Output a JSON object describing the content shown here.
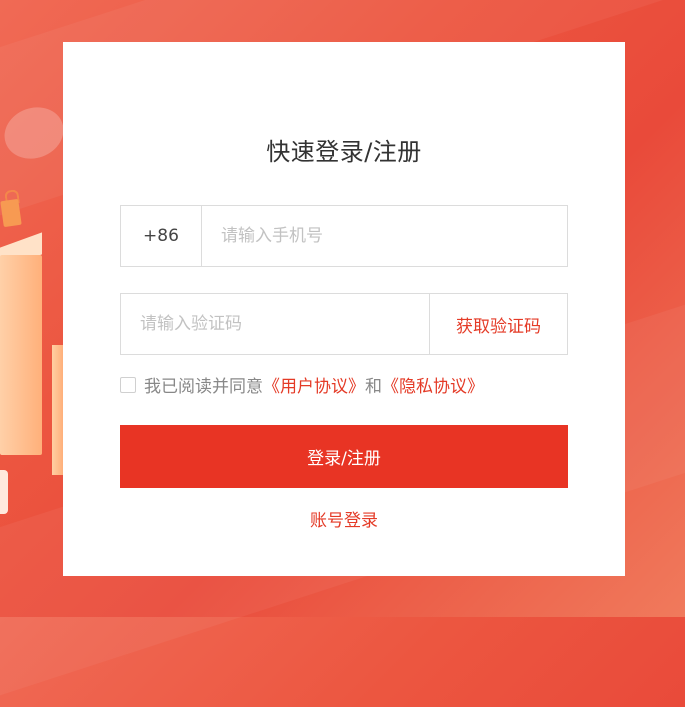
{
  "login": {
    "title": "快速登录/注册",
    "phone": {
      "prefix": "+86",
      "placeholder": "请输入手机号",
      "value": ""
    },
    "code": {
      "placeholder": "请输入验证码",
      "value": "",
      "get_code_label": "获取验证码"
    },
    "agreement": {
      "prefix_text": "我已阅读并同意",
      "user_agreement": "《用户协议》",
      "and_text": "和",
      "privacy_policy": "《隐私协议》",
      "checked": false
    },
    "submit_label": "登录/注册",
    "account_login_label": "账号登录"
  },
  "colors": {
    "accent": "#e83424",
    "link": "#e43a26",
    "background": "#ec5640"
  }
}
